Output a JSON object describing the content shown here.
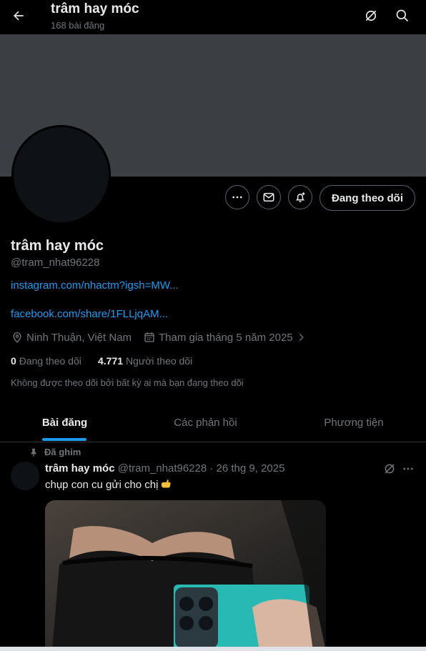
{
  "header": {
    "title": "trâm hay móc",
    "post_count": "168 bài đăng"
  },
  "profile": {
    "name": "trâm hay móc",
    "handle": "@tram_nhat96228",
    "follow_label": "Đang theo dõi",
    "links": [
      "instagram.com/nhactm?igsh=MW...",
      "facebook.com/share/1FLLjqAM..."
    ],
    "location": "Ninh Thuận, Việt Nam",
    "joined": "Tham gia tháng 5 năm 2025",
    "following_count": "0",
    "following_label": "Đang theo dõi",
    "followers_count": "4.771",
    "followers_label": "Người theo dõi",
    "not_followed_note": "Không được theo dõi bởi bất kỳ ai mà bạn đang theo dõi"
  },
  "tabs": [
    {
      "label": "Bài đăng",
      "active": true
    },
    {
      "label": "Các phản hồi",
      "active": false
    },
    {
      "label": "Phương tiện",
      "active": false
    }
  ],
  "pinned_post": {
    "pinned_label": "Đã ghim",
    "author": "trâm hay móc",
    "meta": "@tram_nhat96228 · 26 thg 9, 2025",
    "text": "chụp con cu gửi cho chị"
  },
  "colors": {
    "accent": "#1d9bf0",
    "background": "#000000",
    "banner": "#3b3f43",
    "muted_text": "#71767b"
  },
  "icons": [
    "back-arrow-icon",
    "grok-icon",
    "search-icon",
    "more-icon",
    "mail-icon",
    "bell-plus-icon",
    "location-icon",
    "calendar-icon",
    "pin-icon",
    "pointing-hand-emoji"
  ]
}
